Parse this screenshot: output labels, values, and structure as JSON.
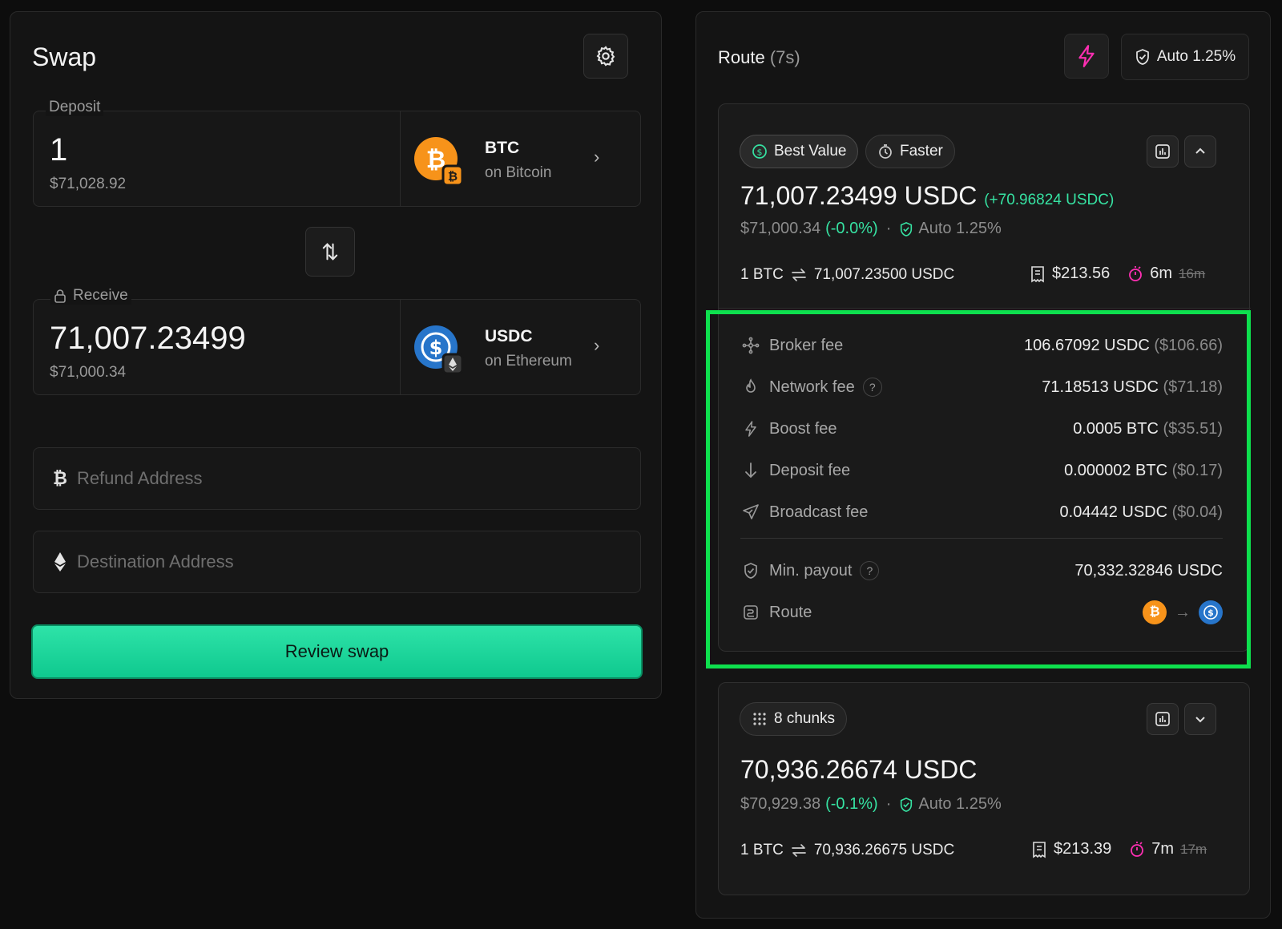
{
  "swap": {
    "title": "Swap",
    "deposit_label": "Deposit",
    "deposit_amount": "1",
    "deposit_usd": "$71,028.92",
    "deposit_token": {
      "symbol": "BTC",
      "chain": "on Bitcoin",
      "icon": "bitcoin-icon",
      "color": "#f7931a"
    },
    "receive_label": "Receive",
    "receive_amount": "71,007.23499",
    "receive_usd": "$71,000.34",
    "receive_token": {
      "symbol": "USDC",
      "chain": "on Ethereum",
      "icon": "usdc-icon",
      "color": "#2775ca"
    },
    "refund_placeholder": "Refund Address",
    "destination_placeholder": "Destination Address",
    "review_button": "Review swap",
    "accent": "#1fd69c"
  },
  "route": {
    "title": "Route",
    "timer": "(7s)",
    "auto_slippage": "Auto 1.25%",
    "bolt_color": "#ff2fb3",
    "card1": {
      "tab_best": "Best Value",
      "tab_faster": "Faster",
      "output": "71,007.23499 USDC",
      "output_diff": "(+70.96824 USDC)",
      "output_usd": "$71,000.34",
      "output_pct": "(-0.0%)",
      "separator": "·",
      "auto": "Auto 1.25%",
      "rate_from": "1 BTC",
      "rate_to": "71,007.23500 USDC",
      "fees_total": "$213.56",
      "time": "6m",
      "time_old": "16m",
      "fees": [
        {
          "label": "Broker fee",
          "icon": "broker-icon",
          "amount": "106.67092 USDC",
          "usd": "($106.66)"
        },
        {
          "label": "Network fee",
          "icon": "flame-icon",
          "amount": "71.18513 USDC",
          "usd": "($71.18)",
          "help": "?"
        },
        {
          "label": "Boost fee",
          "icon": "bolt-icon",
          "amount": "0.0005 BTC",
          "usd": "($35.51)"
        },
        {
          "label": "Deposit fee",
          "icon": "arrow-down-icon",
          "amount": "0.000002 BTC",
          "usd": "($0.17)"
        },
        {
          "label": "Broadcast fee",
          "icon": "send-icon",
          "amount": "0.04442 USDC",
          "usd": "($0.04)"
        }
      ],
      "min_payout_label": "Min. payout",
      "min_payout_help": "?",
      "min_payout": "70,332.32846 USDC",
      "route_label": "Route",
      "route_arrow": "→"
    },
    "card2": {
      "chunks": "8 chunks",
      "output": "70,936.26674 USDC",
      "output_usd": "$70,929.38",
      "output_pct": "(-0.1%)",
      "separator": "·",
      "auto": "Auto 1.25%",
      "rate_from": "1 BTC",
      "rate_to": "70,936.26675 USDC",
      "fees_total": "$213.39",
      "time": "7m",
      "time_old": "17m"
    }
  }
}
